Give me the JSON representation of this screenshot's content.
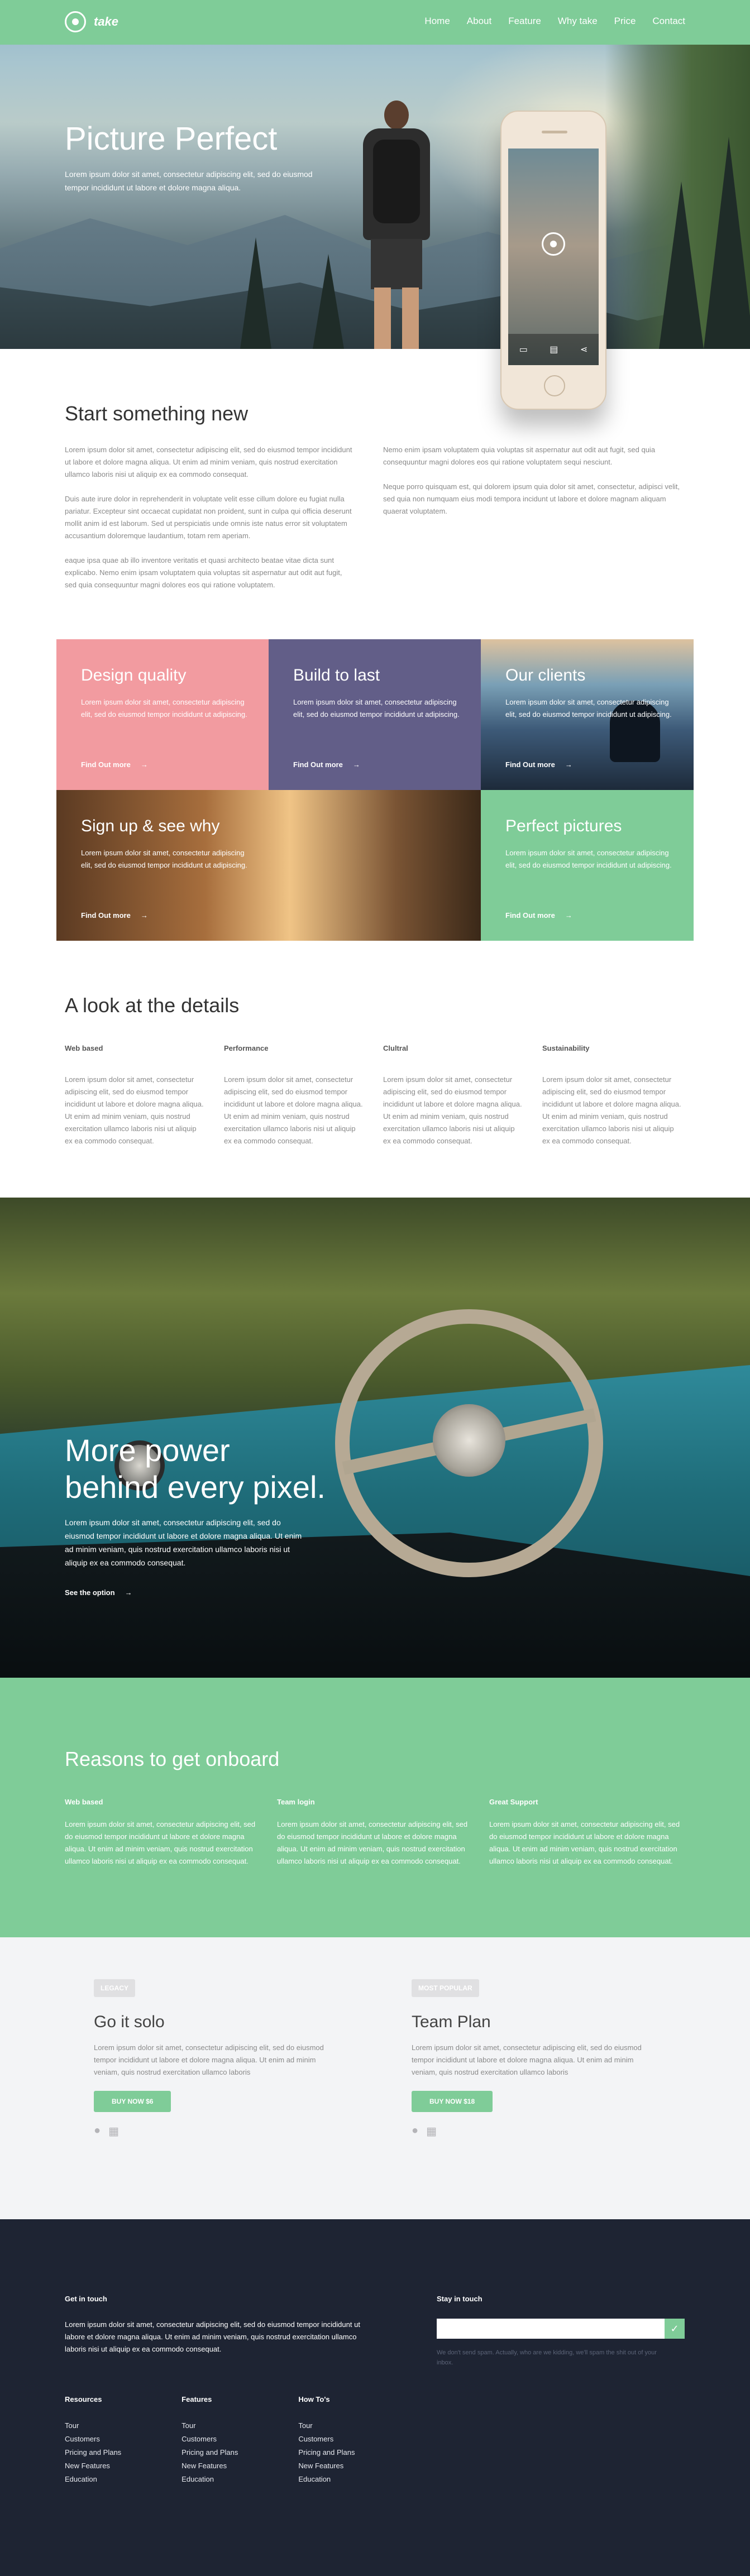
{
  "nav": {
    "brand": "take",
    "items": [
      "Home",
      "About",
      "Feature",
      "Why take",
      "Price",
      "Contact"
    ]
  },
  "hero": {
    "title": "Picture Perfect",
    "text": "Lorem ipsum dolor sit amet, consectetur adipiscing elit, sed do eiusmod tempor incididunt ut labore et dolore magna aliqua."
  },
  "intro": {
    "title": "Start something new",
    "left": [
      "Lorem ipsum dolor sit amet, consectetur adipiscing elit, sed do eiusmod tempor incididunt ut labore et dolore magna aliqua. Ut enim ad minim veniam, quis nostrud exercitation ullamco laboris nisi ut aliquip ex ea commodo consequat.",
      "Duis aute irure dolor in reprehenderit in voluptate velit esse cillum dolore eu fugiat nulla pariatur. Excepteur sint occaecat cupidatat non proident, sunt in culpa qui officia deserunt mollit anim id est laborum. Sed ut perspiciatis unde omnis iste natus error sit voluptatem accusantium doloremque laudantium, totam rem aperiam.",
      "eaque ipsa quae ab illo inventore veritatis et quasi architecto beatae vitae dicta sunt explicabo. Nemo enim ipsam voluptatem quia voluptas sit aspernatur aut odit aut fugit, sed quia consequuntur magni dolores eos qui ratione voluptatem."
    ],
    "right": [
      "Nemo enim ipsam voluptatem quia voluptas sit aspernatur aut odit aut fugit, sed quia consequuntur magni dolores eos qui ratione voluptatem sequi nesciunt.",
      "Neque porro quisquam est, qui dolorem ipsum quia dolor sit amet, consectetur, adipisci velit, sed quia non numquam eius modi tempora incidunt ut labore et dolore magnam aliquam quaerat voluptatem."
    ]
  },
  "tiles": [
    {
      "title": "Design quality",
      "text": "Lorem ipsum dolor sit amet, consectetur adipiscing elit, sed do eiusmod tempor incididunt ut adipiscing.",
      "link": "Find Out more"
    },
    {
      "title": "Build to last",
      "text": "Lorem ipsum dolor sit amet, consectetur adipiscing elit, sed do eiusmod tempor incididunt ut adipiscing.",
      "link": "Find Out more"
    },
    {
      "title": "Our clients",
      "text": "Lorem ipsum dolor sit amet, consectetur adipiscing elit, sed do eiusmod tempor incididunt ut adipiscing.",
      "link": "Find Out more"
    },
    {
      "title": "Sign up & see why",
      "text": "Lorem ipsum dolor sit amet, consectetur adipiscing elit, sed do eiusmod tempor incididunt ut adipiscing.",
      "link": "Find Out more"
    },
    {
      "title": "Perfect pictures",
      "text": "Lorem ipsum dolor sit amet, consectetur adipiscing elit, sed do eiusmod tempor incididunt ut adipiscing.",
      "link": "Find Out more"
    }
  ],
  "details": {
    "title": "A look at the details",
    "items": [
      {
        "heading": "Web based",
        "text": "Lorem ipsum dolor sit amet, consectetur adipiscing elit, sed do eiusmod tempor incididunt ut labore et dolore magna aliqua. Ut enim ad minim veniam, quis nostrud exercitation ullamco laboris nisi ut aliquip ex ea commodo consequat."
      },
      {
        "heading": "Performance",
        "text": "Lorem ipsum dolor sit amet, consectetur adipiscing elit, sed do eiusmod tempor incididunt ut labore et dolore magna aliqua. Ut enim ad minim veniam, quis nostrud exercitation ullamco laboris nisi ut aliquip ex ea commodo consequat."
      },
      {
        "heading": "Clultral",
        "text": "Lorem ipsum dolor sit amet, consectetur adipiscing elit, sed do eiusmod tempor incididunt ut labore et dolore magna aliqua. Ut enim ad minim veniam, quis nostrud exercitation ullamco laboris nisi ut aliquip ex ea commodo consequat."
      },
      {
        "heading": "Sustainability",
        "text": "Lorem ipsum dolor sit amet, consectetur adipiscing elit, sed do eiusmod tempor incididunt ut labore et dolore magna aliqua. Ut enim ad minim veniam, quis nostrud exercitation ullamco laboris nisi ut aliquip ex ea commodo consequat."
      }
    ]
  },
  "power": {
    "title_line1": "More power",
    "title_line2": "behind every pixel.",
    "text": "Lorem ipsum dolor sit amet, consectetur adipiscing elit, sed do eiusmod tempor incididunt ut labore et dolore magna aliqua. Ut enim ad minim veniam, quis nostrud exercitation ullamco laboris nisi ut aliquip ex ea commodo consequat.",
    "link": "See the option"
  },
  "reasons": {
    "title": "Reasons to get onboard",
    "items": [
      {
        "heading": "Web based",
        "text": "Lorem ipsum dolor sit amet, consectetur adipiscing elit, sed do eiusmod tempor incididunt ut labore et dolore magna aliqua. Ut enim ad minim veniam, quis nostrud exercitation ullamco laboris nisi ut aliquip ex ea commodo consequat."
      },
      {
        "heading": "Team login",
        "text": "Lorem ipsum dolor sit amet, consectetur adipiscing elit, sed do eiusmod tempor incididunt ut labore et dolore magna aliqua. Ut enim ad minim veniam, quis nostrud exercitation ullamco laboris nisi ut aliquip ex ea commodo consequat."
      },
      {
        "heading": "Great Support",
        "text": "Lorem ipsum dolor sit amet, consectetur adipiscing elit, sed do eiusmod tempor incididunt ut labore et dolore magna aliqua. Ut enim ad minim veniam, quis nostrud exercitation ullamco laboris nisi ut aliquip ex ea commodo consequat."
      }
    ]
  },
  "pricing": [
    {
      "badge": "LEGACY",
      "title": "Go it solo",
      "text": "Lorem ipsum dolor sit amet, consectetur adipiscing elit, sed do eiusmod tempor incididunt ut labore et dolore magna aliqua. Ut enim ad minim veniam, quis nostrud exercitation ullamco laboris",
      "button": "BUY NOW $6"
    },
    {
      "badge": "MOST POPULAR",
      "title": "Team Plan",
      "text": "Lorem ipsum dolor sit amet, consectetur adipiscing elit, sed do eiusmod tempor incididunt ut labore et dolore magna aliqua. Ut enim ad minim veniam, quis nostrud exercitation ullamco laboris",
      "button": "BUY NOW $18"
    }
  ],
  "footer": {
    "touch_title": "Get in touch",
    "touch_text": "Lorem ipsum dolor sit amet, consectetur adipiscing elit, sed do eiusmod tempor incididunt ut labore et dolore magna aliqua. Ut enim ad minim veniam, quis nostrud exercitation ullamco laboris nisi ut aliquip ex ea commodo consequat.",
    "stay_title": "Stay in touch",
    "stay_note": "We don't send spam. Actually, who are we kidding, we'll spam the shit out of your inbox.",
    "columns": [
      {
        "title": "Resources",
        "links": [
          "Tour",
          "Customers",
          "Pricing and Plans",
          "New Features",
          "Education"
        ]
      },
      {
        "title": "Features",
        "links": [
          "Tour",
          "Customers",
          "Pricing and Plans",
          "New Features",
          "Education"
        ]
      },
      {
        "title": "How To's",
        "links": [
          "Tour",
          "Customers",
          "Pricing and Plans",
          "New Features",
          "Education"
        ]
      }
    ]
  },
  "colors": {
    "accent": "#7fcc98",
    "pink": "#f29ba0",
    "purple": "#625e88",
    "footer": "#1e2433"
  }
}
